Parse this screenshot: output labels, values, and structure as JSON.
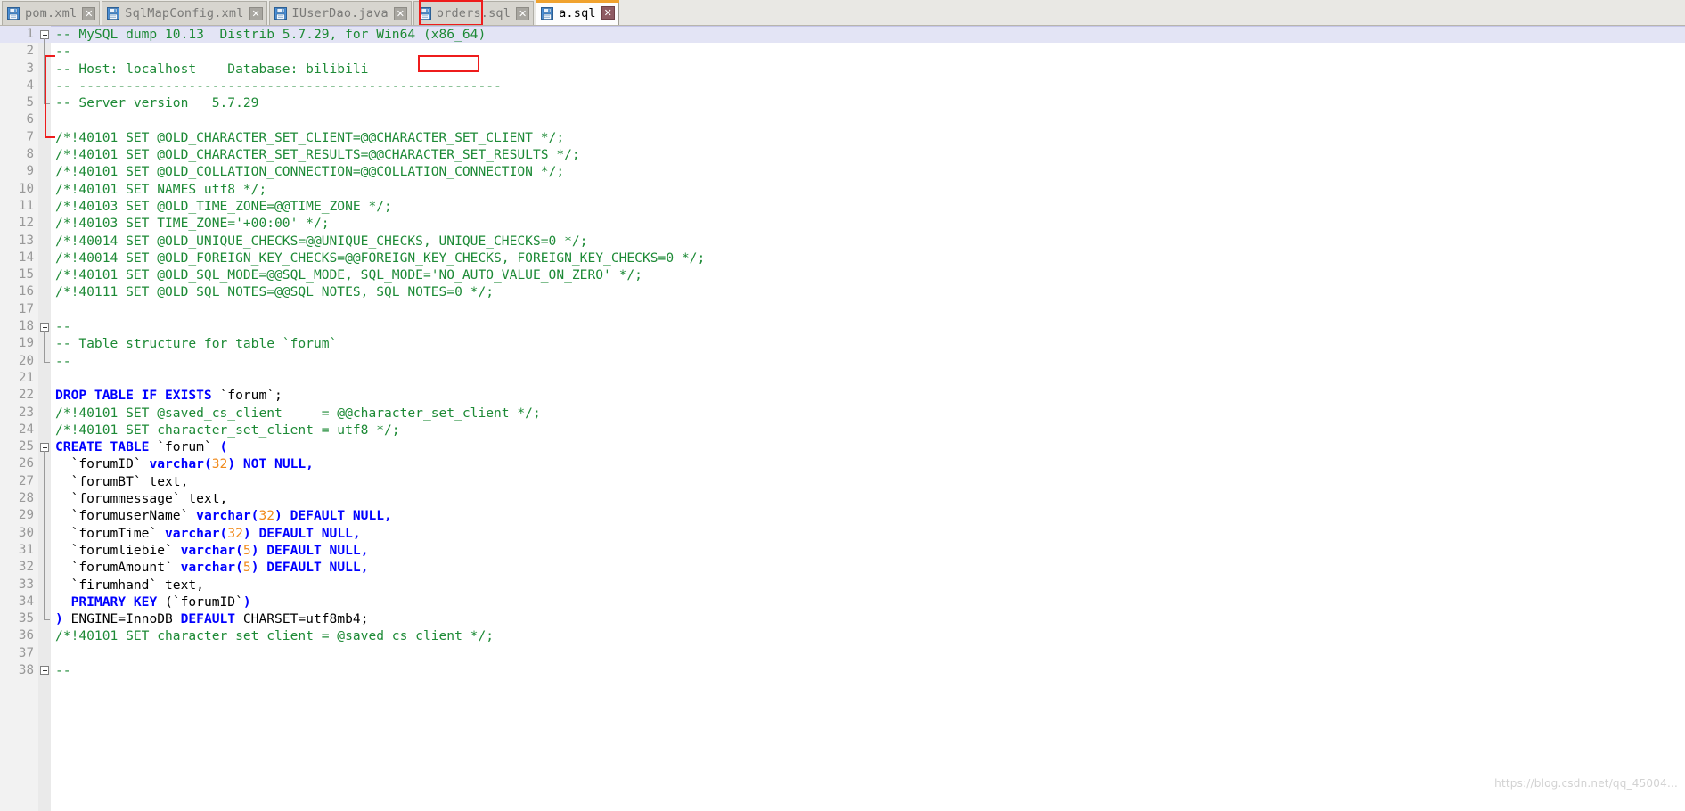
{
  "window": {
    "app": "Eclipse IDE SQL Editor",
    "active_file": "a.sql"
  },
  "tabs": [
    {
      "label": "pom.xml",
      "icon": "file-save-icon",
      "close": "✕",
      "active": false
    },
    {
      "label": "SqlMapConfig.xml",
      "icon": "file-save-icon",
      "close": "✕",
      "active": false
    },
    {
      "label": "IUserDao.java",
      "icon": "file-save-icon",
      "close": "✕",
      "active": false
    },
    {
      "label": "orders.sql",
      "icon": "file-save-icon",
      "close": "✕",
      "active": false
    },
    {
      "label": "a.sql",
      "icon": "file-save-icon",
      "close": "✕",
      "active": true
    }
  ],
  "editor": {
    "first_line": 1,
    "last_line": 38,
    "current_line": 1,
    "fold_markers": [
      1,
      18,
      25,
      38
    ],
    "language": "SQL",
    "colors": {
      "comment": "#1d8a36",
      "keyword": "#0000ff",
      "number": "#f08a1c",
      "text": "#000000",
      "current_line_bg": "#e3e4f5",
      "gutter_bg": "#f2f2f2",
      "annotation": "#ee1c1c",
      "active_tab_top": "#f0a22e"
    },
    "lines": [
      {
        "n": 1,
        "fold": "minus",
        "tokens": [
          {
            "t": "cmt",
            "v": "-- MySQL dump 10.13  Distrib 5.7.29, for Win64 (x86_64)"
          }
        ]
      },
      {
        "n": 2,
        "tokens": [
          {
            "t": "cmt",
            "v": "--"
          }
        ]
      },
      {
        "n": 3,
        "tokens": [
          {
            "t": "cmt",
            "v": "-- Host: localhost    Database: bilibili"
          }
        ]
      },
      {
        "n": 4,
        "tokens": [
          {
            "t": "cmt",
            "v": "-- ------------------------------------------------------"
          }
        ]
      },
      {
        "n": 5,
        "tokens": [
          {
            "t": "cmt",
            "v": "-- Server version   5.7.29"
          }
        ]
      },
      {
        "n": 6,
        "tokens": []
      },
      {
        "n": 7,
        "tokens": [
          {
            "t": "cmt",
            "v": "/*!40101 SET @OLD_CHARACTER_SET_CLIENT=@@CHARACTER_SET_CLIENT */;"
          }
        ]
      },
      {
        "n": 8,
        "tokens": [
          {
            "t": "cmt",
            "v": "/*!40101 SET @OLD_CHARACTER_SET_RESULTS=@@CHARACTER_SET_RESULTS */;"
          }
        ]
      },
      {
        "n": 9,
        "tokens": [
          {
            "t": "cmt",
            "v": "/*!40101 SET @OLD_COLLATION_CONNECTION=@@COLLATION_CONNECTION */;"
          }
        ]
      },
      {
        "n": 10,
        "tokens": [
          {
            "t": "cmt",
            "v": "/*!40101 SET NAMES utf8 */;"
          }
        ]
      },
      {
        "n": 11,
        "tokens": [
          {
            "t": "cmt",
            "v": "/*!40103 SET @OLD_TIME_ZONE=@@TIME_ZONE */;"
          }
        ]
      },
      {
        "n": 12,
        "tokens": [
          {
            "t": "cmt",
            "v": "/*!40103 SET TIME_ZONE='+00:00' */;"
          }
        ]
      },
      {
        "n": 13,
        "tokens": [
          {
            "t": "cmt",
            "v": "/*!40014 SET @OLD_UNIQUE_CHECKS=@@UNIQUE_CHECKS, UNIQUE_CHECKS=0 */;"
          }
        ]
      },
      {
        "n": 14,
        "tokens": [
          {
            "t": "cmt",
            "v": "/*!40014 SET @OLD_FOREIGN_KEY_CHECKS=@@FOREIGN_KEY_CHECKS, FOREIGN_KEY_CHECKS=0 */;"
          }
        ]
      },
      {
        "n": 15,
        "tokens": [
          {
            "t": "cmt",
            "v": "/*!40101 SET @OLD_SQL_MODE=@@SQL_MODE, SQL_MODE='NO_AUTO_VALUE_ON_ZERO' */;"
          }
        ]
      },
      {
        "n": 16,
        "tokens": [
          {
            "t": "cmt",
            "v": "/*!40111 SET @OLD_SQL_NOTES=@@SQL_NOTES, SQL_NOTES=0 */;"
          }
        ]
      },
      {
        "n": 17,
        "tokens": []
      },
      {
        "n": 18,
        "fold": "minus",
        "tokens": [
          {
            "t": "cmt",
            "v": "--"
          }
        ]
      },
      {
        "n": 19,
        "tokens": [
          {
            "t": "cmt",
            "v": "-- Table structure for table `forum`"
          }
        ]
      },
      {
        "n": 20,
        "tokens": [
          {
            "t": "cmt",
            "v": "--"
          }
        ]
      },
      {
        "n": 21,
        "tokens": []
      },
      {
        "n": 22,
        "tokens": [
          {
            "t": "kw",
            "v": "DROP TABLE IF EXISTS"
          },
          {
            "t": "id",
            "v": " `forum`;"
          }
        ]
      },
      {
        "n": 23,
        "tokens": [
          {
            "t": "cmt",
            "v": "/*!40101 SET @saved_cs_client     = @@character_set_client */;"
          }
        ]
      },
      {
        "n": 24,
        "tokens": [
          {
            "t": "cmt",
            "v": "/*!40101 SET character_set_client = utf8 */;"
          }
        ]
      },
      {
        "n": 25,
        "fold": "minus",
        "tokens": [
          {
            "t": "kw",
            "v": "CREATE TABLE"
          },
          {
            "t": "id",
            "v": " `forum` "
          },
          {
            "t": "kw",
            "v": "("
          }
        ]
      },
      {
        "n": 26,
        "tokens": [
          {
            "t": "id",
            "v": "  `forumID` "
          },
          {
            "t": "kw",
            "v": "varchar("
          },
          {
            "t": "num",
            "v": "32"
          },
          {
            "t": "kw",
            "v": ") NOT NULL,"
          }
        ]
      },
      {
        "n": 27,
        "tokens": [
          {
            "t": "id",
            "v": "  `forumBT` text,"
          }
        ]
      },
      {
        "n": 28,
        "tokens": [
          {
            "t": "id",
            "v": "  `forummessage` text,"
          }
        ]
      },
      {
        "n": 29,
        "tokens": [
          {
            "t": "id",
            "v": "  `forumuserName` "
          },
          {
            "t": "kw",
            "v": "varchar("
          },
          {
            "t": "num",
            "v": "32"
          },
          {
            "t": "kw",
            "v": ") DEFAULT NULL,"
          }
        ]
      },
      {
        "n": 30,
        "tokens": [
          {
            "t": "id",
            "v": "  `forumTime` "
          },
          {
            "t": "kw",
            "v": "varchar("
          },
          {
            "t": "num",
            "v": "32"
          },
          {
            "t": "kw",
            "v": ") DEFAULT NULL,"
          }
        ]
      },
      {
        "n": 31,
        "tokens": [
          {
            "t": "id",
            "v": "  `forumliebie` "
          },
          {
            "t": "kw",
            "v": "varchar("
          },
          {
            "t": "num",
            "v": "5"
          },
          {
            "t": "kw",
            "v": ") DEFAULT NULL,"
          }
        ]
      },
      {
        "n": 32,
        "tokens": [
          {
            "t": "id",
            "v": "  `forumAmount` "
          },
          {
            "t": "kw",
            "v": "varchar("
          },
          {
            "t": "num",
            "v": "5"
          },
          {
            "t": "kw",
            "v": ") DEFAULT NULL,"
          }
        ]
      },
      {
        "n": 33,
        "tokens": [
          {
            "t": "id",
            "v": "  `firumhand` text,"
          }
        ]
      },
      {
        "n": 34,
        "tokens": [
          {
            "t": "id",
            "v": "  "
          },
          {
            "t": "kw",
            "v": "PRIMARY KEY"
          },
          {
            "t": "id",
            "v": " (`forumID`"
          },
          {
            "t": "kw",
            "v": ")"
          }
        ]
      },
      {
        "n": 35,
        "fold": "end",
        "tokens": [
          {
            "t": "kw",
            "v": ")"
          },
          {
            "t": "id",
            "v": " ENGINE=InnoDB "
          },
          {
            "t": "kw",
            "v": "DEFAULT"
          },
          {
            "t": "id",
            "v": " CHARSET=utf8mb4;"
          }
        ]
      },
      {
        "n": 36,
        "tokens": [
          {
            "t": "cmt",
            "v": "/*!40101 SET character_set_client = @saved_cs_client */;"
          }
        ]
      },
      {
        "n": 37,
        "tokens": []
      },
      {
        "n": 38,
        "fold": "minus",
        "tokens": [
          {
            "t": "cmt",
            "v": "--"
          }
        ]
      }
    ]
  },
  "annotation": {
    "kind": "red-rectangle-callout",
    "target_text": "Win64"
  },
  "watermark": {
    "text": "https://blog.csdn.net/qq_45004..."
  }
}
